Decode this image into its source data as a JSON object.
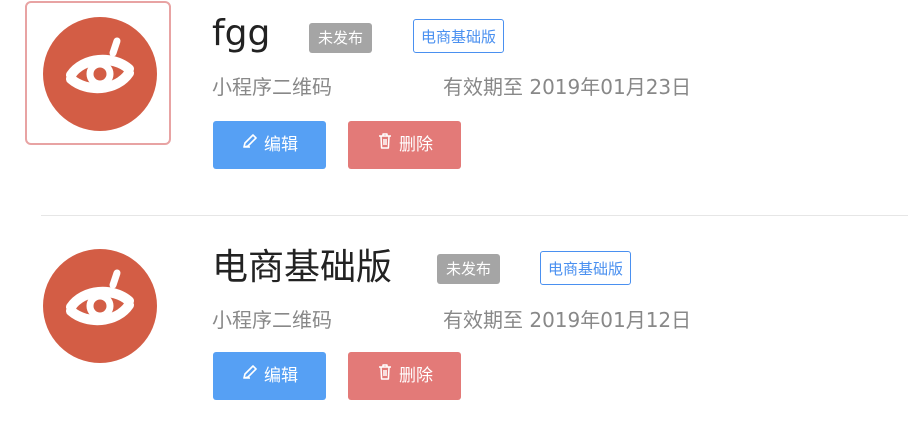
{
  "apps": [
    {
      "title": "fgg",
      "status": "未发布",
      "version": "电商基础版",
      "qrcode_label": "小程序二维码",
      "expiry": "有效期至 2019年01月23日",
      "edit_label": "编辑",
      "delete_label": "删除",
      "selected": true
    },
    {
      "title": "电商基础版",
      "status": "未发布",
      "version": "电商基础版",
      "qrcode_label": "小程序二维码",
      "expiry": "有效期至 2019年01月12日",
      "edit_label": "编辑",
      "delete_label": "删除",
      "selected": false
    }
  ],
  "colors": {
    "logo": "#d35d45",
    "edit": "#56a0f4",
    "delete": "#e37a78",
    "status_badge": "#a5a5a5",
    "version_badge": "#4a90f0"
  },
  "icons": {
    "logo": "app-logo-icon",
    "edit": "pencil-icon",
    "delete": "trash-icon"
  }
}
